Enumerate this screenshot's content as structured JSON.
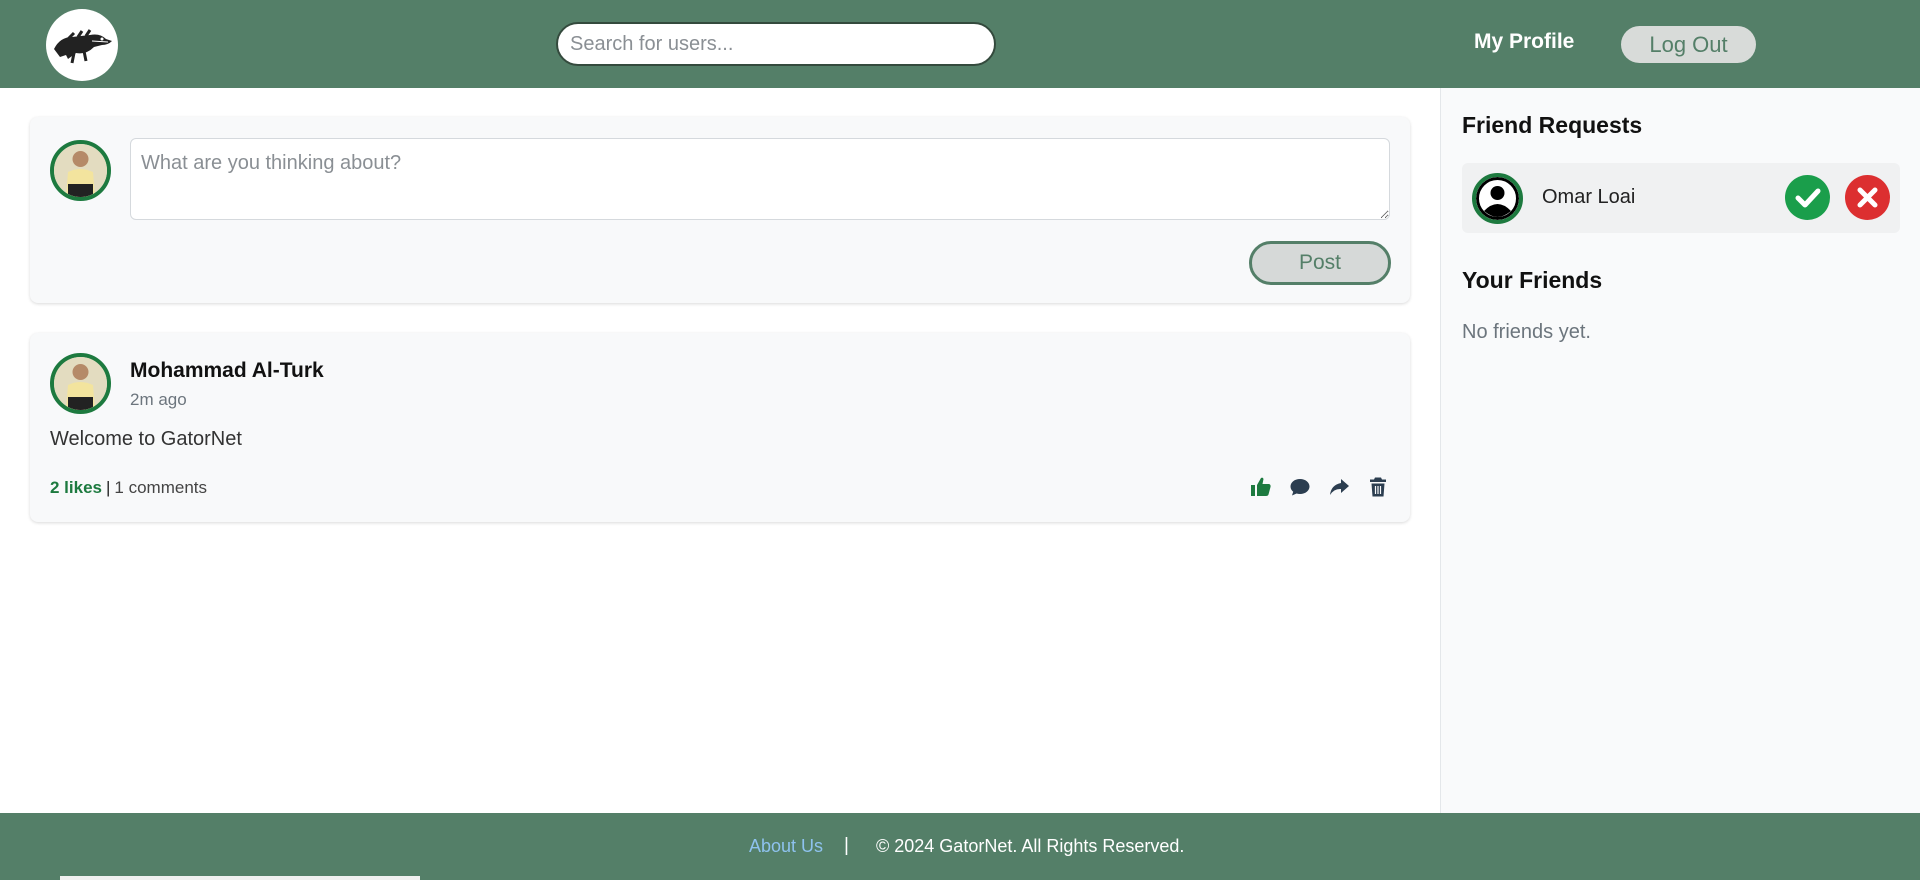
{
  "header": {
    "search_placeholder": "Search for users...",
    "my_profile_label": "My Profile",
    "logout_label": "Log Out"
  },
  "composer": {
    "placeholder": "What are you thinking about?",
    "post_label": "Post"
  },
  "post": {
    "author": "Mohammad Al-Turk",
    "time": "2m ago",
    "text": "Welcome to GatorNet",
    "likes": "2 likes",
    "separator": "|",
    "comments": "1 comments"
  },
  "sidebar": {
    "requests_title": "Friend Requests",
    "requests": [
      {
        "name": "Omar Loai"
      }
    ],
    "friends_title": "Your Friends",
    "friends_empty": "No friends yet."
  },
  "footer": {
    "about_label": "About Us",
    "divider": "|",
    "copyright": "© 2024 GatorNet. All Rights Reserved."
  },
  "colors": {
    "brand_green": "#547f68",
    "accent_green": "#1d7a3f",
    "accept_green": "#1a9e4b",
    "reject_red": "#dc2f30",
    "link_blue": "#8ec2ee"
  },
  "icons": {
    "logo": "crocodile-logo-icon",
    "like": "thumbs-up-icon",
    "comment": "comment-bubble-icon",
    "share": "share-arrow-icon",
    "delete": "trash-icon",
    "accept": "checkmark-icon",
    "reject": "x-mark-icon",
    "default_avatar": "user-circle-icon"
  }
}
